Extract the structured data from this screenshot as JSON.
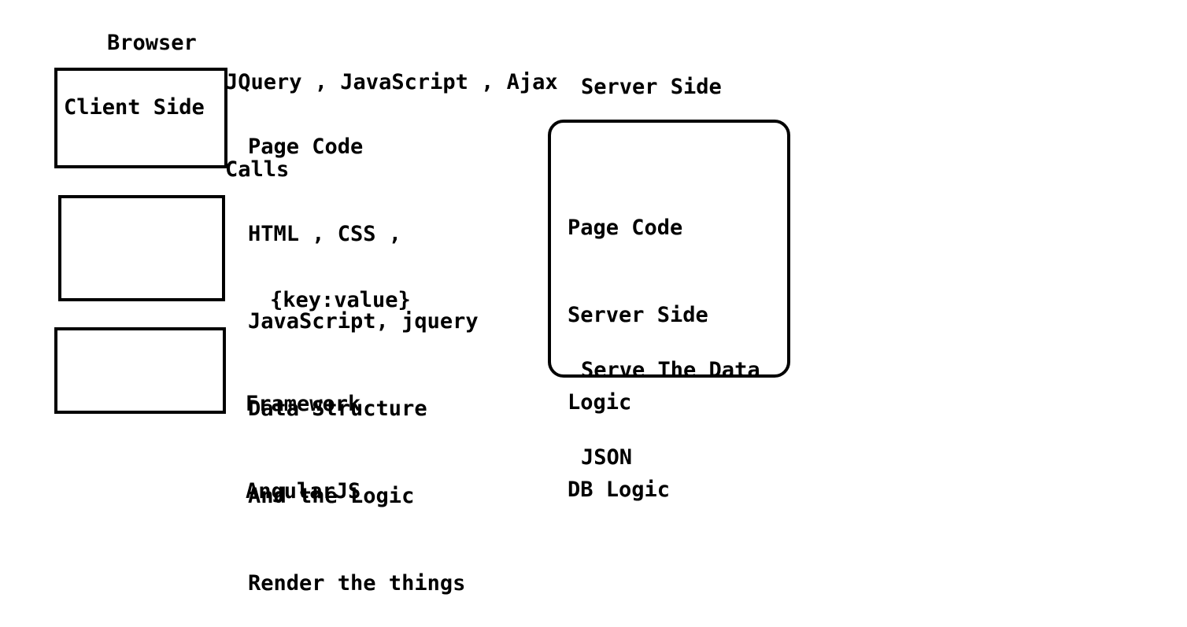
{
  "browser_label": "Browser",
  "client_calls": {
    "lines": [
      "JQuery , JavaScript , Ajax",
      "Calls"
    ]
  },
  "client_box_1": {
    "label": "Client Side"
  },
  "client_notes": {
    "lines": [
      "Page Code",
      "HTML , CSS ,",
      "JavaScript, jquery",
      "Data Structure",
      "And the Logic",
      "Render the things"
    ]
  },
  "key_value_label": "{key:value}",
  "framework_notes": {
    "lines": [
      "Framework",
      "AngularJS"
    ]
  },
  "server_title": "Server Side",
  "server_box": {
    "lines": [
      "Page Code",
      "Server Side",
      "Logic",
      "DB Logic"
    ],
    "serve_lines": [
      "Serve The Data",
      "JSON"
    ]
  }
}
